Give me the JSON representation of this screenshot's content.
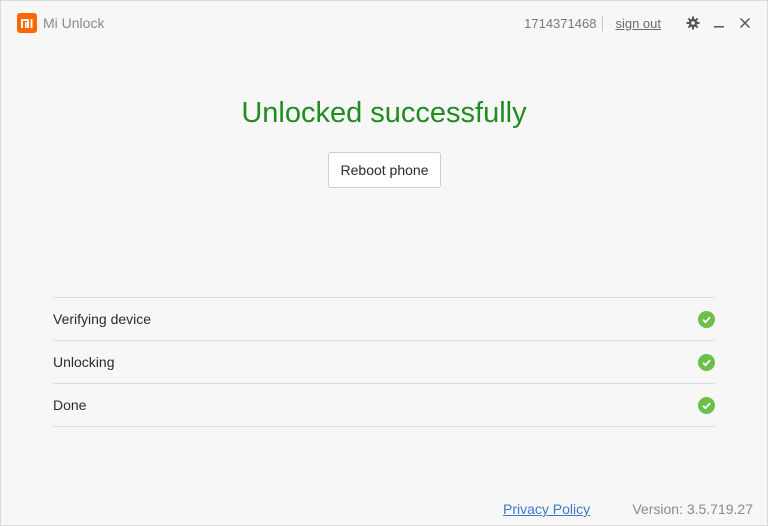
{
  "app": {
    "logo_text": "mi",
    "title": "Mi Unlock",
    "brand_color": "#ff6700"
  },
  "header": {
    "user_id": "1714371468",
    "sign_out_label": "sign out",
    "icons": [
      "gear-icon",
      "minimize-icon",
      "close-icon"
    ]
  },
  "main": {
    "headline": "Unlocked successfully",
    "headline_color": "#1f8c1f",
    "reboot_label": "Reboot phone"
  },
  "steps": [
    {
      "label": "Verifying device",
      "status": "done",
      "icon": "check-circle-icon"
    },
    {
      "label": "Unlocking",
      "status": "done",
      "icon": "check-circle-icon"
    },
    {
      "label": "Done",
      "status": "done",
      "icon": "check-circle-icon"
    }
  ],
  "footer": {
    "privacy_label": "Privacy Policy",
    "version_label": "Version: 3.5.719.27"
  }
}
